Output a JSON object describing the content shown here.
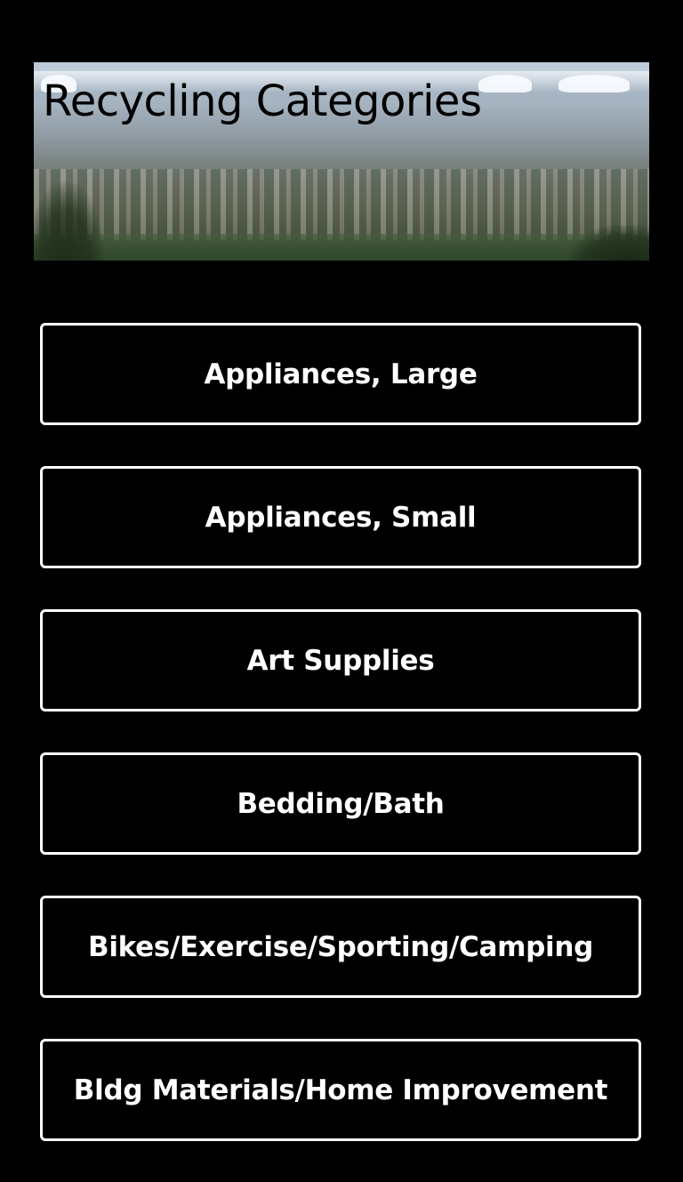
{
  "header": {
    "title": "Recycling Categories"
  },
  "categories": [
    {
      "label": "Appliances, Large"
    },
    {
      "label": "Appliances, Small"
    },
    {
      "label": "Art Supplies"
    },
    {
      "label": "Bedding/Bath"
    },
    {
      "label": "Bikes/Exercise/Sporting/Camping"
    },
    {
      "label": "Bldg Materials/Home Improvement"
    }
  ],
  "colors": {
    "background": "#000000",
    "button_border": "#ffffff",
    "button_text": "#ffffff",
    "title_text": "#000000"
  }
}
